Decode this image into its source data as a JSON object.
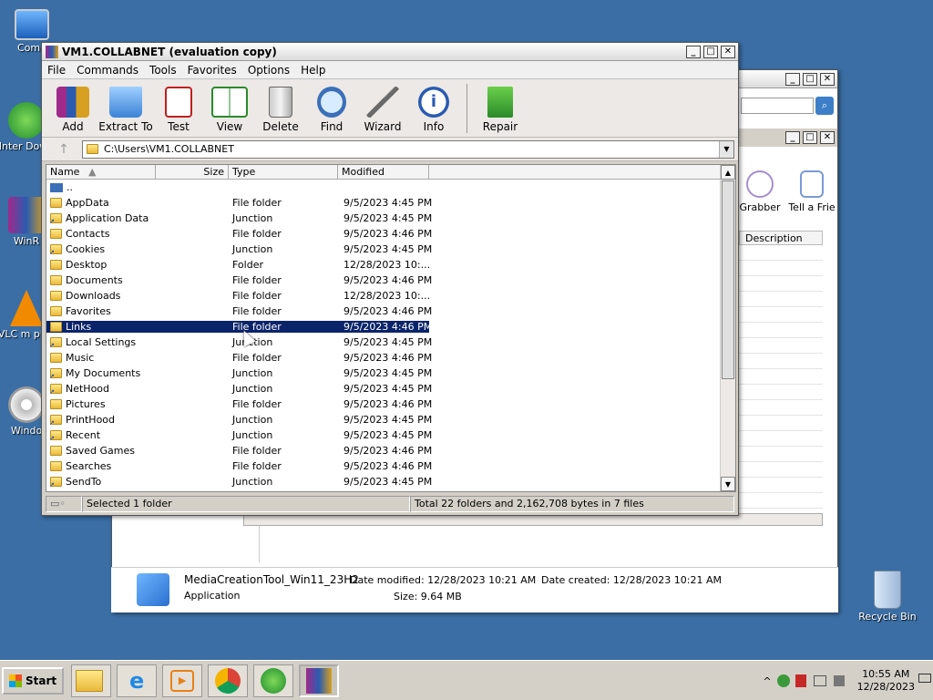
{
  "desktop": {
    "icons": [
      {
        "label": "Comp"
      },
      {
        "label": "Inter Down"
      },
      {
        "label": "WinR"
      },
      {
        "label": "VLC m play"
      },
      {
        "label": "Windo"
      },
      {
        "label": "Recycle Bin"
      }
    ]
  },
  "winrar": {
    "title": "VM1.COLLABNET (evaluation copy)",
    "menu": [
      "File",
      "Commands",
      "Tools",
      "Favorites",
      "Options",
      "Help"
    ],
    "toolbar": [
      {
        "label": "Add",
        "icon": "add-icon"
      },
      {
        "label": "Extract To",
        "icon": "extract-icon"
      },
      {
        "label": "Test",
        "icon": "test-icon"
      },
      {
        "label": "View",
        "icon": "view-icon"
      },
      {
        "label": "Delete",
        "icon": "delete-icon"
      },
      {
        "label": "Find",
        "icon": "find-icon"
      },
      {
        "label": "Wizard",
        "icon": "wizard-icon"
      },
      {
        "label": "Info",
        "icon": "info-icon"
      },
      {
        "label": "Repair",
        "icon": "repair-icon"
      }
    ],
    "path": "C:\\Users\\VM1.COLLABNET",
    "columns": {
      "name": "Name",
      "size": "Size",
      "type": "Type",
      "modified": "Modified"
    },
    "parent": "..",
    "rows": [
      {
        "name": "AppData",
        "type": "File folder",
        "modified": "9/5/2023 4:45 PM",
        "junction": false
      },
      {
        "name": "Application Data",
        "type": "Junction",
        "modified": "9/5/2023 4:45 PM",
        "junction": true
      },
      {
        "name": "Contacts",
        "type": "File folder",
        "modified": "9/5/2023 4:46 PM",
        "junction": false
      },
      {
        "name": "Cookies",
        "type": "Junction",
        "modified": "9/5/2023 4:45 PM",
        "junction": true
      },
      {
        "name": "Desktop",
        "type": "Folder",
        "modified": "12/28/2023 10:...",
        "junction": false
      },
      {
        "name": "Documents",
        "type": "File folder",
        "modified": "9/5/2023 4:46 PM",
        "junction": false
      },
      {
        "name": "Downloads",
        "type": "File folder",
        "modified": "12/28/2023 10:...",
        "junction": false
      },
      {
        "name": "Favorites",
        "type": "File folder",
        "modified": "9/5/2023 4:46 PM",
        "junction": false
      },
      {
        "name": "Links",
        "type": "File folder",
        "modified": "9/5/2023 4:46 PM",
        "junction": false,
        "selected": true
      },
      {
        "name": "Local Settings",
        "type": "Junction",
        "modified": "9/5/2023 4:45 PM",
        "junction": true
      },
      {
        "name": "Music",
        "type": "File folder",
        "modified": "9/5/2023 4:46 PM",
        "junction": false
      },
      {
        "name": "My Documents",
        "type": "Junction",
        "modified": "9/5/2023 4:45 PM",
        "junction": true
      },
      {
        "name": "NetHood",
        "type": "Junction",
        "modified": "9/5/2023 4:45 PM",
        "junction": true
      },
      {
        "name": "Pictures",
        "type": "File folder",
        "modified": "9/5/2023 4:46 PM",
        "junction": false
      },
      {
        "name": "PrintHood",
        "type": "Junction",
        "modified": "9/5/2023 4:45 PM",
        "junction": true
      },
      {
        "name": "Recent",
        "type": "Junction",
        "modified": "9/5/2023 4:45 PM",
        "junction": true
      },
      {
        "name": "Saved Games",
        "type": "File folder",
        "modified": "9/5/2023 4:46 PM",
        "junction": false
      },
      {
        "name": "Searches",
        "type": "File folder",
        "modified": "9/5/2023 4:46 PM",
        "junction": false
      },
      {
        "name": "SendTo",
        "type": "Junction",
        "modified": "9/5/2023 4:45 PM",
        "junction": true
      }
    ],
    "status_left": "Selected 1 folder",
    "status_right": "Total 22 folders and 2,162,708 bytes in 7 files"
  },
  "explorer": {
    "toolbar_labels": [
      "Grabber",
      "Tell a Frie"
    ],
    "column_description": "Description",
    "details": {
      "filename": "MediaCreationTool_Win11_23H2",
      "filetype": "Application",
      "date_modified_label": "Date modified:",
      "date_modified": "12/28/2023 10:21 AM",
      "date_created_label": "Date created:",
      "date_created": "12/28/2023 10:21 AM",
      "size_label": "Size:",
      "size": "9.64 MB"
    }
  },
  "taskbar": {
    "start": "Start",
    "time": "10:55 AM",
    "date": "12/28/2023"
  },
  "colors": {
    "desktop": "#3a6ea5",
    "selection": "#0a246a"
  }
}
